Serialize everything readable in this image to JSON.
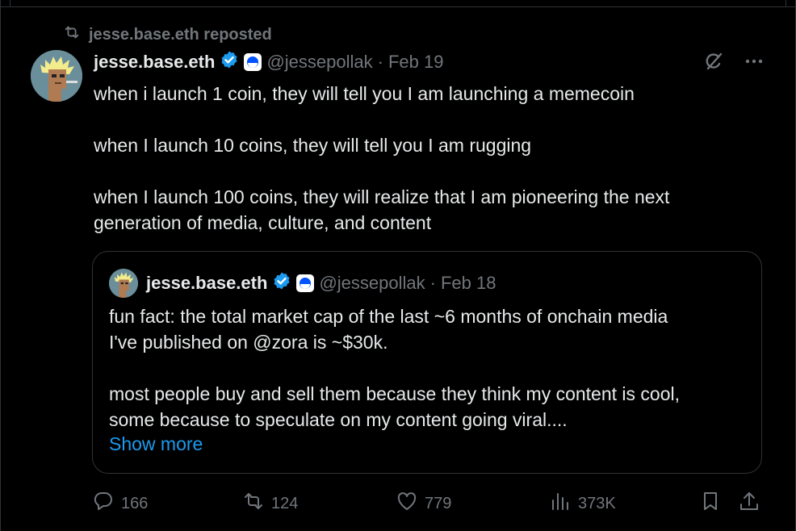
{
  "repost": {
    "label": "jesse.base.eth reposted"
  },
  "tweet": {
    "display_name": "jesse.base.eth",
    "handle": "@jessepollak",
    "separator": "·",
    "date": "Feb 19",
    "lines": [
      "when i launch 1 coin, they will tell you I am launching a memecoin",
      "",
      "when I launch 10 coins, they will tell you I am rugging",
      "",
      "when I launch 100 coins, they will realize that I am pioneering the next",
      "generation of media, culture, and content"
    ]
  },
  "quote": {
    "display_name": "jesse.base.eth",
    "handle": "@jessepollak",
    "separator": "·",
    "date": "Feb 18",
    "lines": [
      "fun fact: the total market cap of the last ~6 months of onchain media",
      "I've published on @zora is ~$30k.",
      "",
      "most people buy and sell them because they think my content is cool,",
      "some because to speculate on my content going viral...."
    ],
    "show_more": "Show more"
  },
  "actions": {
    "replies": "166",
    "reposts": "124",
    "likes": "779",
    "views": "373K"
  },
  "colors": {
    "background": "#000000",
    "text": "#e7e9ea",
    "muted": "#71767b",
    "link": "#1d9bf0",
    "verified": "#1d9bf0",
    "border": "#2f3336"
  },
  "icons": {
    "repost_header": "repost-icon",
    "verified": "verified-badge-icon",
    "base": "base-logo-icon",
    "grok": "grok-icon",
    "more": "more-icon",
    "reply": "reply-icon",
    "repost": "repost-icon",
    "like": "like-icon",
    "views": "views-icon",
    "bookmark": "bookmark-icon",
    "share": "share-icon"
  }
}
